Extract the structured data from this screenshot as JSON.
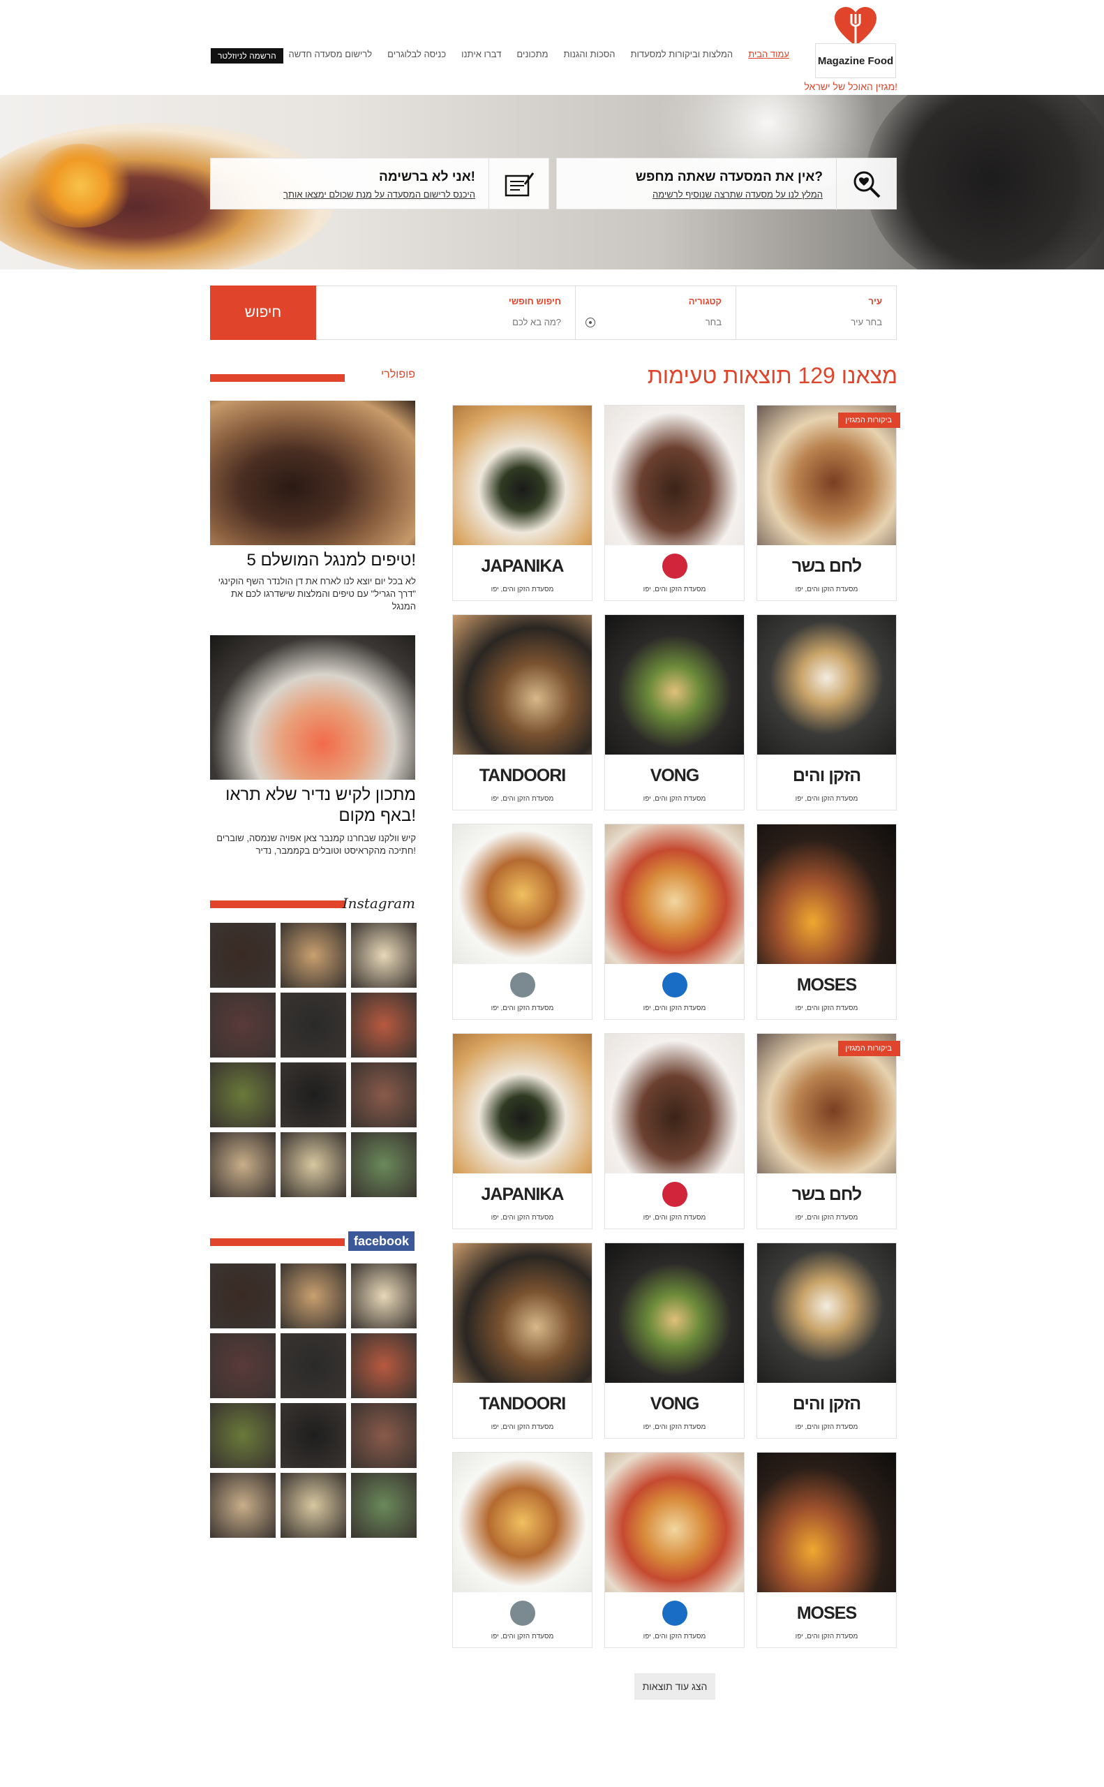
{
  "header": {
    "logo_text": "Magazine Food",
    "tagline": "מגזין האוכל של ישראל!",
    "nav": [
      "עמוד הבית",
      "המלצות וביקורות למסעדות",
      "הסכות והגנות",
      "מתכונים",
      "דברו איתנו",
      "כניסה לבלוגרים",
      "לרישום מסעדה חדשה"
    ],
    "newsletter_btn": "הרשמה לניוזלטר"
  },
  "hero": {
    "card1": {
      "title": "אין את המסעדה שאתה מחפש?",
      "link": "המלץ לנו על מסעדה שתרצה שנוסיף לרשימה",
      "icon": "search-heart-icon"
    },
    "card2": {
      "title": "אני לא ברשימה!",
      "link": "היכנס לרישום המסעדה על מנת שכולם ימצאו אותך",
      "icon": "edit-note-icon"
    }
  },
  "search": {
    "city_label": "עיר",
    "city_value": "בחר עיר",
    "category_label": "קטגוריה",
    "category_value": "בחר",
    "free_label": "חיפוש חופשי",
    "free_placeholder": "מה בא לכם?",
    "button": "חיפוש"
  },
  "results": {
    "title": "מצאנו 129 תוצאות טעימות",
    "ribbon": "ביקורות המגזין",
    "card_sub": "מסעדת הזקן והים, יפו",
    "cards": [
      {
        "logo": "לחם בשר",
        "ribbon": true
      },
      {
        "logo": "",
        "ribbon": false
      },
      {
        "logo": "JAPANIKA",
        "ribbon": false
      },
      {
        "logo": "הזקן והים",
        "ribbon": false
      },
      {
        "logo": "VONG",
        "ribbon": false
      },
      {
        "logo": "TANDOORI",
        "ribbon": false
      },
      {
        "logo": "MOSES",
        "ribbon": false
      },
      {
        "logo": "",
        "ribbon": false
      },
      {
        "logo": "",
        "ribbon": false
      },
      {
        "logo": "לחם בשר",
        "ribbon": true
      },
      {
        "logo": "",
        "ribbon": false
      },
      {
        "logo": "JAPANIKA",
        "ribbon": false
      },
      {
        "logo": "הזקן והים",
        "ribbon": false
      },
      {
        "logo": "VONG",
        "ribbon": false
      },
      {
        "logo": "TANDOORI",
        "ribbon": false
      },
      {
        "logo": "MOSES",
        "ribbon": false
      },
      {
        "logo": "",
        "ribbon": false
      },
      {
        "logo": "",
        "ribbon": false
      }
    ],
    "more_btn": "הצג עוד תוצאות"
  },
  "sidebar": {
    "popular_label": "פופולרי",
    "posts": [
      {
        "title": "5 טיפים למנגל המושלם!",
        "desc": "לא בכל יום יוצא לנו לארח את דן הולנדר השף הוקינגי \"דרך הגריל\" עם טיפים והמלצות שישדרגו לכם את המנגל"
      },
      {
        "title": "מתכון לקיש נדיר שלא תראו באף מקום!",
        "desc": "קיש וולקנו שבחרנו קמנבר צאן אפויה שנמסה, שוברים חתיכה מהקראיסט וטובלים בקממבר, נדיר!"
      }
    ],
    "instagram_label": "Instagram",
    "facebook_label": "facebook"
  }
}
